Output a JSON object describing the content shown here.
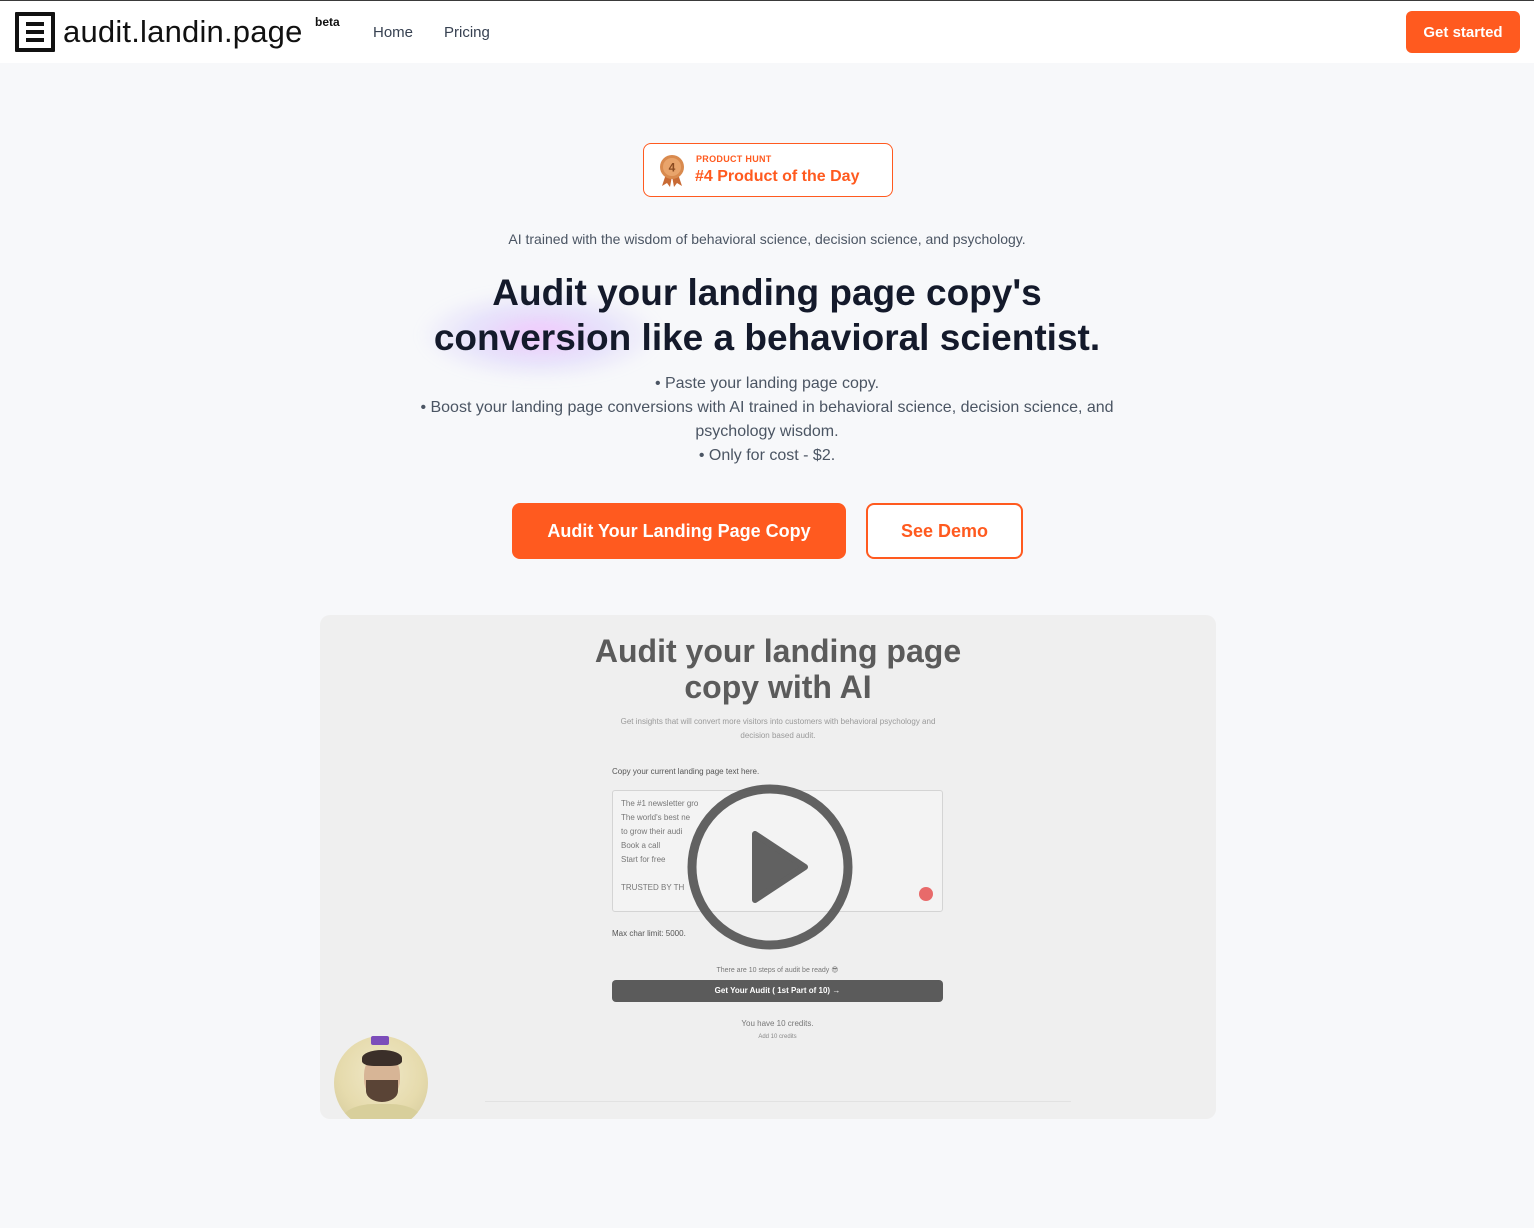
{
  "nav": {
    "logo_text": "audit.landin.page",
    "logo_badge": "beta",
    "links": [
      "Home",
      "Pricing"
    ],
    "cta": "Get started"
  },
  "badge": {
    "label": "PRODUCT HUNT",
    "title": "#4 Product of the Day",
    "medal_number": "4"
  },
  "hero": {
    "tagline": "AI trained with the wisdom of behavioral science, decision science, and psychology.",
    "headline_line1": "Audit your landing page copy's",
    "headline_line2": "conversion like a behavioral scientist.",
    "bullets": [
      "• Paste your landing page copy.",
      "• Boost your landing page conversions with AI trained in behavioral science, decision science, and psychology wisdom.",
      "• Only for cost - $2."
    ],
    "primary_cta": "Audit Your Landing Page Copy",
    "secondary_cta": "See Demo"
  },
  "video": {
    "title_line1": "Audit your landing page",
    "title_line2": "copy with AI",
    "subtitle": "Get insights that will convert more visitors into customers with behavioral psychology and decision based audit.",
    "copy_label": "Copy your current landing page text here.",
    "textarea_lines": [
      "The #1 newsletter gro",
      "The world's best ne",
      "to grow their audi",
      "Book a call",
      "Start for free",
      "",
      "TRUSTED BY TH"
    ],
    "char_limit": "Max char limit: 5000.",
    "steps_note": "There are 10 steps of audit be ready 😎",
    "cta": "Get Your Audit ( 1st Part of 10) →",
    "credits": "You have 10 credits.",
    "add_credits": "Add 10 credits"
  },
  "colors": {
    "accent": "#ff5a1f",
    "heading": "#141a2b",
    "body": "#4b5563",
    "background": "#f7f8fa"
  },
  "icons": {
    "medal": "medal-icon",
    "play": "play-icon"
  }
}
